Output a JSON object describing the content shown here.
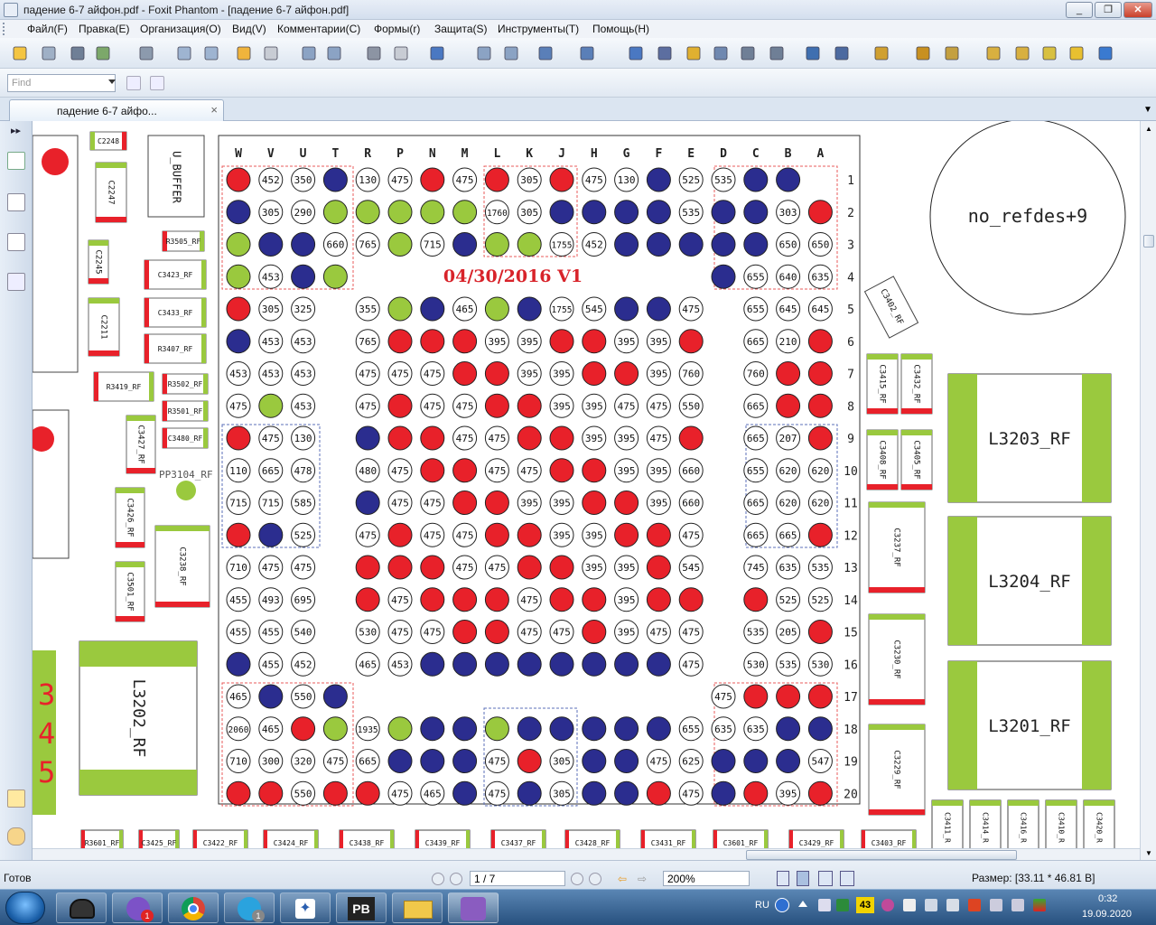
{
  "window": {
    "title": "падение 6-7 айфон.pdf - Foxit Phantom - [падение 6-7 айфон.pdf]",
    "min": "_",
    "restore": "❐",
    "close": "✕"
  },
  "menu": {
    "items": [
      "Файл(F)",
      "Правка(E)",
      "Организация(O)",
      "Вид(V)",
      "Комментарии(C)",
      "Формы(r)",
      "Защита(S)",
      "Инструменты(T)",
      "Помощь(H)"
    ]
  },
  "toolbar": {
    "icons": [
      "open-icon",
      "save-icon",
      "print-icon",
      "email-icon",
      "scanner-icon",
      "prev-page-icon",
      "next-page-icon",
      "back-icon",
      "forward-icon",
      "extract-pages-icon",
      "insert-pages-icon",
      "undo-icon",
      "redo-icon",
      "zoom-icon",
      "fit-page-icon",
      "fit-width-icon",
      "zoom-out-icon",
      "zoom-in-icon",
      "hand-tool-icon",
      "snapshot-icon",
      "select-arrow-icon",
      "binoculars-icon",
      "text-select-icon",
      "camera-icon",
      "rectangle-icon",
      "typewriter-icon",
      "stamp-icon",
      "sign-icon",
      "lock-icon",
      "notes-icon",
      "form-icon",
      "text-tool-icon",
      "comment-icon",
      "arrow-icon"
    ]
  },
  "find": {
    "placeholder": "Find"
  },
  "tab": {
    "label": "падение 6-7 айфо...",
    "close": "×"
  },
  "status": {
    "ready": "Готов",
    "page": "1 / 7",
    "zoom": "200%",
    "size": "Размер: [33.11 * 46.81 В]"
  },
  "taskbar": {
    "lang": "RU",
    "time": "0:32",
    "date": "19.09.2020",
    "badge1": "1",
    "badge2": "1",
    "badge43": "43",
    "apps": [
      "media-icon",
      "viber-icon",
      "chrome-icon",
      "telegram-icon",
      "compass-icon",
      "pb-icon",
      "explorer-icon",
      "foxit-icon"
    ],
    "pb": "PB"
  },
  "schematic": {
    "title": "04/30/2016 V1",
    "columns": [
      "W",
      "V",
      "U",
      "T",
      "R",
      "P",
      "N",
      "M",
      "L",
      "K",
      "J",
      "H",
      "G",
      "F",
      "E",
      "D",
      "C",
      "B",
      "A"
    ],
    "rows": [
      "1",
      "2",
      "3",
      "4",
      "5",
      "6",
      "7",
      "8",
      "9",
      "10",
      "11",
      "12",
      "13",
      "14",
      "15",
      "16",
      "17",
      "18",
      "19",
      "20"
    ],
    "grid": [
      [
        "r",
        "452",
        "350",
        "b",
        "130",
        "475",
        "r",
        "475",
        "r",
        "305",
        "r",
        "475",
        "130",
        "b",
        "525",
        "535",
        "b",
        "b",
        ""
      ],
      [
        "b",
        "305",
        "290",
        "g",
        "g",
        "g",
        "g",
        "g",
        "1760",
        "305",
        "b",
        "b",
        "b",
        "b",
        "535",
        "b",
        "b",
        "303",
        "r"
      ],
      [
        "g",
        "b",
        "b",
        "660",
        "765",
        "g",
        "715",
        "b",
        "g",
        "g",
        "1755",
        "452",
        "b",
        "b",
        "b",
        "b",
        "b",
        "650",
        "650"
      ],
      [
        "g",
        "453",
        "b",
        "g",
        "",
        "",
        "",
        "",
        "",
        "",
        "",
        "",
        "",
        "",
        "",
        "b",
        "655",
        "640",
        "635"
      ],
      [
        "r",
        "305",
        "325",
        "",
        "355",
        "g",
        "b",
        "465",
        "g",
        "b",
        "1755",
        "545",
        "b",
        "b",
        "475",
        "",
        "655",
        "645",
        "645"
      ],
      [
        "b",
        "453",
        "453",
        "",
        "765",
        "r",
        "r",
        "r",
        "395",
        "395",
        "r",
        "r",
        "395",
        "395",
        "r",
        "",
        "665",
        "210",
        "r"
      ],
      [
        "453",
        "453",
        "453",
        "",
        "475",
        "475",
        "475",
        "r",
        "r",
        "395",
        "395",
        "r",
        "r",
        "395",
        "760",
        "",
        "760",
        "r",
        "r"
      ],
      [
        "475",
        "g",
        "453",
        "",
        "475",
        "r",
        "475",
        "475",
        "r",
        "r",
        "395",
        "395",
        "475",
        "475",
        "550",
        "",
        "665",
        "r",
        "r"
      ],
      [
        "r",
        "475",
        "130",
        "",
        "b",
        "r",
        "r",
        "475",
        "475",
        "r",
        "r",
        "395",
        "395",
        "475",
        "r",
        "",
        "665",
        "207",
        "r"
      ],
      [
        "110",
        "665",
        "478",
        "",
        "480",
        "475",
        "r",
        "r",
        "475",
        "475",
        "r",
        "r",
        "395",
        "395",
        "660",
        "",
        "655",
        "620",
        "620"
      ],
      [
        "715",
        "715",
        "585",
        "",
        "b",
        "475",
        "475",
        "r",
        "r",
        "395",
        "395",
        "r",
        "r",
        "395",
        "660",
        "",
        "665",
        "620",
        "620"
      ],
      [
        "r",
        "b",
        "525",
        "",
        "475",
        "r",
        "475",
        "475",
        "r",
        "r",
        "395",
        "395",
        "r",
        "r",
        "475",
        "",
        "665",
        "665",
        "r"
      ],
      [
        "710",
        "475",
        "475",
        "",
        "r",
        "r",
        "r",
        "475",
        "475",
        "r",
        "r",
        "395",
        "395",
        "r",
        "545",
        "",
        "745",
        "635",
        "535"
      ],
      [
        "455",
        "493",
        "695",
        "",
        "r",
        "475",
        "r",
        "r",
        "r",
        "475",
        "r",
        "r",
        "395",
        "r",
        "r",
        "",
        "r",
        "525",
        "525"
      ],
      [
        "455",
        "455",
        "540",
        "",
        "530",
        "475",
        "475",
        "r",
        "r",
        "475",
        "475",
        "r",
        "395",
        "475",
        "475",
        "",
        "535",
        "205",
        "r"
      ],
      [
        "b",
        "455",
        "452",
        "",
        "465",
        "453",
        "b",
        "b",
        "b",
        "b",
        "b",
        "b",
        "b",
        "b",
        "475",
        "",
        "530",
        "535",
        "530"
      ],
      [
        "465",
        "b",
        "550",
        "b",
        "",
        "",
        "",
        "",
        "",
        "",
        "",
        "",
        "",
        "",
        "",
        "475",
        "r",
        "r",
        "r"
      ],
      [
        "2060",
        "465",
        "r",
        "g",
        "1935",
        "g",
        "b",
        "b",
        "g",
        "b",
        "b",
        "b",
        "b",
        "b",
        "655",
        "635",
        "635",
        "b",
        "b"
      ],
      [
        "710",
        "300",
        "320",
        "475",
        "665",
        "b",
        "b",
        "b",
        "475",
        "r",
        "305",
        "b",
        "b",
        "475",
        "625",
        "b",
        "b",
        "b",
        "547"
      ],
      [
        "r",
        "r",
        "550",
        "r",
        "r",
        "475",
        "465",
        "b",
        "475",
        "b",
        "305",
        "b",
        "b",
        "r",
        "475",
        "b",
        "r",
        "395",
        "r"
      ]
    ],
    "components": {
      "c2248": "C2248",
      "u_buffer": "U_BUFFER",
      "c2247": "C2247",
      "r3505": "R3505_RF",
      "c2245": "C2245",
      "c3423": "C3423_RF",
      "c3433": "C3433_RF",
      "c2211": "C2211",
      "r3407": "R3407_RF",
      "r3419": "R3419_RF",
      "r3502": "R3502_RF",
      "r3501": "R3501_RF",
      "c3480": "C3480_RF",
      "c3427": "C3427_RF",
      "pp3104": "PP3104_RF",
      "c3426": "C3426_RF",
      "c3238": "C3238_RF",
      "c3501": "C3501_RF",
      "l3202": "L3202_RF",
      "no_refdes": "no_refdes+9",
      "c3402": "C3402_RF",
      "c3415": "C3415_RF",
      "c3432": "C3432_RF",
      "c3408": "C3408_RF",
      "c3405": "C3405_RF",
      "l3203": "L3203_RF",
      "c3237": "C3237_RF",
      "l3204": "L3204_RF",
      "c3230": "C3230_RF",
      "l3201": "L3201_RF",
      "c3229": "C3229_RF",
      "bottom": [
        "R3601_RF",
        "C3425_RF",
        "C3422_RF",
        "C3424_RF",
        "C3438_RF",
        "C3439_RF",
        "C3437_RF",
        "C3428_RF",
        "C3431_RF",
        "C3601_RF",
        "C3429_RF",
        "C3403_RF"
      ],
      "bottom_right": [
        "C3411_R",
        "C3414_R",
        "C3416_R",
        "C3410_R",
        "C3420_R"
      ],
      "left_numbers": [
        "3",
        "4",
        "5"
      ]
    }
  },
  "colors": {
    "red": "#e8212a",
    "blue": "#2b2d8f",
    "green": "#9ac93e",
    "dash_red": "#e85b5b",
    "dash_blue": "#5b6fb8"
  }
}
